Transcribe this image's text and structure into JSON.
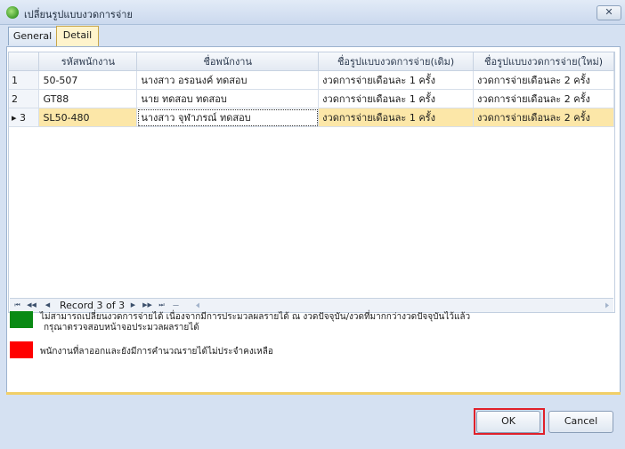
{
  "window": {
    "title": "เปลี่ยนรูปแบบงวดการจ่าย",
    "close_label": "✕"
  },
  "tabs": [
    {
      "label": "General"
    },
    {
      "label": "Detail"
    }
  ],
  "grid": {
    "columns": [
      "รหัสพนักงาน",
      "ชื่อพนักงาน",
      "ชื่อรูปแบบงวดการจ่าย(เดิม)",
      "ชื่อรูปแบบงวดการจ่าย(ใหม่)"
    ],
    "rows": [
      {
        "num": "1",
        "code": "50-507",
        "name": "นางสาว อรอนงค์ ทดสอบ",
        "old": "งวดการจ่ายเดือนละ 1 ครั้ง",
        "new": "งวดการจ่ายเดือนละ 2 ครั้ง"
      },
      {
        "num": "2",
        "code": "GT88",
        "name": "นาย ทดสอบ ทดสอบ",
        "old": "งวดการจ่ายเดือนละ 1 ครั้ง",
        "new": "งวดการจ่ายเดือนละ 2 ครั้ง"
      },
      {
        "num": "3",
        "code": "SL50-480",
        "name": "นางสาว จุฬาภรณ์ ทดสอบ",
        "old": "งวดการจ่ายเดือนละ 1 ครั้ง",
        "new": "งวดการจ่ายเดือนละ 2 ครั้ง"
      }
    ],
    "selected_row_marker": "▸"
  },
  "navigator": {
    "record_text": "Record 3 of 3",
    "first": "⏮",
    "prev_page": "◀◀",
    "prev": "◀",
    "next": "▶",
    "next_page": "▶▶",
    "last": "⏭",
    "extra": "—"
  },
  "legend": [
    {
      "color": "#0a8a14",
      "line1": "ไม่สามารถเปลี่ยนงวดการจ่ายได้ เนื่องจากมีการประมวลผลรายได้ ณ งวดปัจจุบัน/งวดที่มากกว่างวดปัจจุบันไว้แล้ว",
      "line2": "กรุณาตรวจสอบหน้าจอประมวลผลรายได้"
    },
    {
      "color": "#ff0000",
      "line1": "พนักงานที่ลาออกและยังมีการคำนวณรายได้ไม่ประจำคงเหลือ"
    }
  ],
  "buttons": {
    "ok": "OK",
    "cancel": "Cancel"
  }
}
